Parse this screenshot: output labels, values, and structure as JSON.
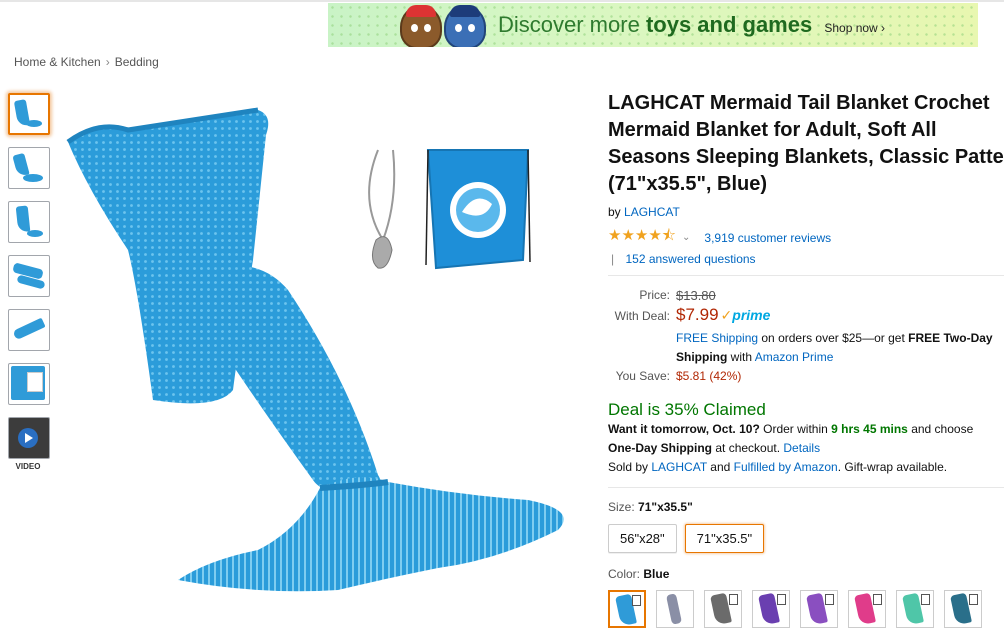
{
  "banner": {
    "text_prefix": "Discover more",
    "text_bold": "toys and games",
    "shop_now": "Shop now ›"
  },
  "breadcrumb": {
    "items": [
      "Home & Kitchen",
      "Bedding"
    ],
    "separator": "›"
  },
  "thumbnails": {
    "count": 7,
    "video_label": "VIDEO"
  },
  "product": {
    "title_lines": [
      "LAGHCAT Mermaid Tail Blanket Crochet",
      "Mermaid Blanket for Adult, Soft All",
      "Seasons Sleeping Blankets, Classic Pattern",
      "(71\"x35.5\", Blue)"
    ],
    "by_prefix": "by",
    "brand": "LAGHCAT",
    "rating": 4.5,
    "stars_text": "★★★★⯪",
    "chevron": "⌄",
    "reviews": "3,919 customer reviews",
    "qa_separator": "|",
    "answered": "152 answered questions"
  },
  "price": {
    "price_label": "Price:",
    "list_price": "$13.80",
    "deal_label": "With Deal:",
    "deal_price": "$7.99",
    "prime_check": "✓",
    "prime_word": "prime",
    "shipping_link": "FREE Shipping",
    "shipping_text": " on orders over $25—or get ",
    "shipping_bold": "FREE Two-Day",
    "shipping_bold2": "Shipping",
    "shipping_with": " with ",
    "amazon_prime": "Amazon Prime",
    "save_label": "You Save:",
    "save_value": "$5.81 (42%)"
  },
  "deal": {
    "claimed": "Deal is 35% Claimed"
  },
  "delivery": {
    "want_prefix": "Want it tomorrow, Oct. 10?",
    "order_within": " Order within ",
    "time_left": "9 hrs 45 mins",
    "and_choose": " and choose",
    "one_day": "One-Day Shipping",
    "at_checkout": " at checkout. ",
    "details": "Details",
    "sold_by": "Sold by ",
    "seller": "LAGHCAT",
    "and": " and ",
    "fulfilled": "Fulfilled by Amazon",
    "gift": ". Gift-wrap available."
  },
  "size": {
    "label": "Size:",
    "selected": "71\"x35.5\"",
    "options": [
      "56\"x28\"",
      "71\"x35.5\""
    ]
  },
  "color": {
    "label": "Color:",
    "selected": "Blue",
    "swatches": [
      "#2f9bd8",
      "#8a8fa6",
      "#6b6b6b",
      "#6a3fb0",
      "#8a4fc0",
      "#e03c8a",
      "#4fc6a8",
      "#2a6f8a"
    ]
  }
}
